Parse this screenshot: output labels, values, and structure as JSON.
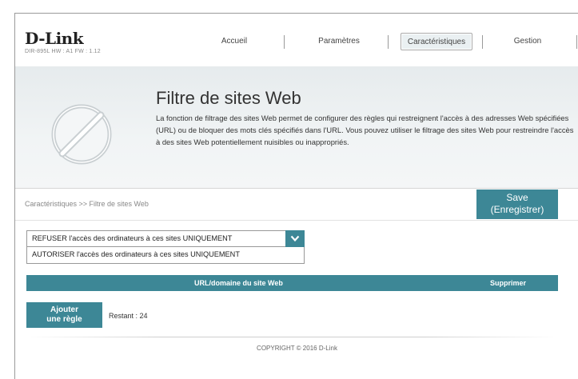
{
  "header": {
    "logo": "D-Link",
    "logo_sub": "DIR-895L  HW : A1   FW : 1.12",
    "nav": [
      {
        "label": "Accueil"
      },
      {
        "label": "Paramètres"
      },
      {
        "label": "Caractéristiques",
        "active": true
      },
      {
        "label": "Gestion"
      }
    ]
  },
  "banner": {
    "icon": "forbidden-circle-icon",
    "title": "Filtre de sites Web",
    "description": "La fonction de filtrage des sites Web permet de configurer des règles qui restreignent l'accès à des adresses Web spécifiées (URL) ou de bloquer des mots clés spécifiés dans l'URL. Vous pouvez utiliser le filtrage des sites Web pour restreindre l'accès à des sites Web potentiellement nuisibles ou inappropriés."
  },
  "breadcrumb": "Caractéristiques >> Filtre de sites Web",
  "save_button": {
    "line1": "Save",
    "line2": "(Enregistrer)"
  },
  "filter_mode": {
    "selected": "REFUSER l'accès des ordinateurs à ces sites UNIQUEMENT",
    "options": [
      "AUTORISER l'accès des ordinateurs à ces sites UNIQUEMENT"
    ]
  },
  "table": {
    "columns": [
      "URL/domaine du site Web",
      "Supprimer"
    ],
    "rows": []
  },
  "add_rule": {
    "line1": "Ajouter",
    "line2": "une règle"
  },
  "remaining": "Restant : 24",
  "copyright": "COPYRIGHT © 2016 D-Link",
  "colors": {
    "accent": "#3d8796",
    "banner_bg": "#eef2f3"
  }
}
